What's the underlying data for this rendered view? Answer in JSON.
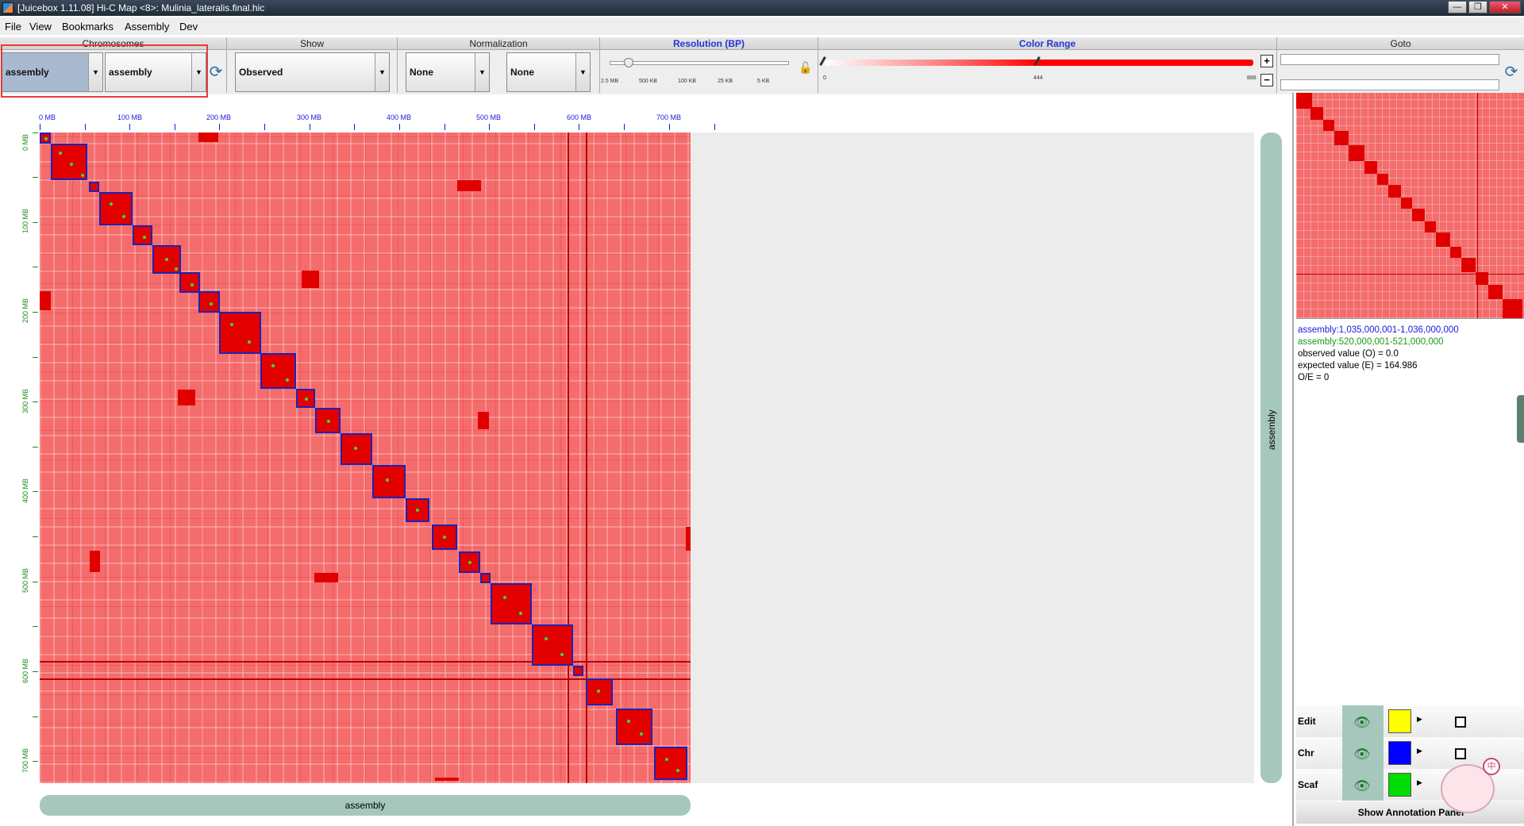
{
  "window": {
    "title": "[Juicebox 1.11.08] Hi-C Map <8>: Mulinia_lateralis.final.hic",
    "btn_min": "—",
    "btn_max": "❐",
    "btn_close": "✕"
  },
  "menu": [
    "File",
    "View",
    "Bookmarks",
    "Assembly",
    "Dev"
  ],
  "toolbar": {
    "chromosomes": {
      "header": "Chromosomes",
      "x_value": "assembly",
      "y_value": "assembly"
    },
    "show": {
      "header": "Show",
      "value": "Observed"
    },
    "normalization": {
      "header": "Normalization",
      "value1": "None",
      "value2": "None"
    },
    "resolution": {
      "header": "Resolution (BP)",
      "ticks": [
        "2.5 MB",
        "500 KB",
        "100 KB",
        "25 KB",
        "5 KB"
      ],
      "selected_index": 1
    },
    "color_range": {
      "header": "Color Range",
      "min": "0",
      "mid": "444",
      "max": "888"
    },
    "goto": {
      "header": "Goto",
      "input1": "",
      "input2": ""
    }
  },
  "axis": {
    "x_ticks": [
      "0 MB",
      "100 MB",
      "200 MB",
      "300 MB",
      "400 MB",
      "500 MB",
      "600 MB",
      "700 MB"
    ],
    "y_ticks": [
      "0 MB",
      "100 MB",
      "200 MB",
      "300 MB",
      "400 MB",
      "500 MB",
      "600 MB",
      "700 MB"
    ],
    "x_track_label": "assembly",
    "y_track_label": "assembly"
  },
  "info": {
    "line1": "assembly:1,035,000,001-1,036,000,000",
    "line2": "assembly:520,000,001-521,000,000",
    "line3": "observed value (O) = 0.0",
    "line4": "expected value (E) = 164.986",
    "line5": "O/E = 0"
  },
  "annotations": {
    "rows": [
      {
        "label": "Edit",
        "color": "#ffff00"
      },
      {
        "label": "Chr",
        "color": "#0000ff"
      },
      {
        "label": "Scaf",
        "color": "#00dd00"
      }
    ],
    "footer": "Show Annotation Panel"
  },
  "mascot": {
    "badge": "中"
  },
  "colors": {
    "accent_blue": "#1f35d6",
    "heatmap_red": "#e30000",
    "block_border": "#1a23b8",
    "track_teal": "#a6c8bc"
  }
}
